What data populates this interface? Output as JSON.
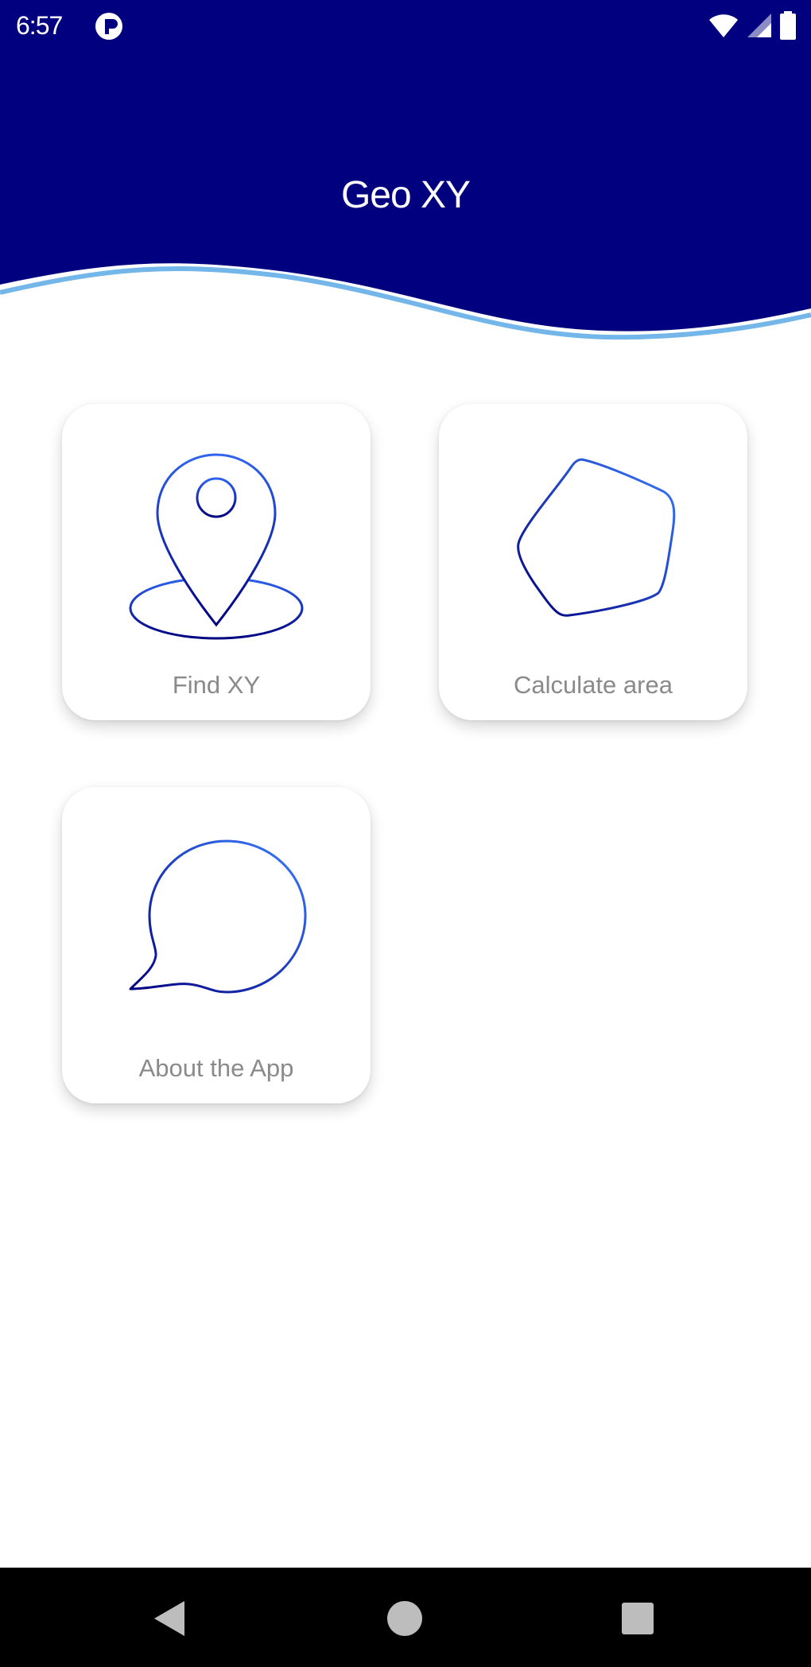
{
  "status_bar": {
    "time": "6:57",
    "icons": [
      "app-notification-icon",
      "wifi-icon",
      "cellular-signal-icon",
      "battery-icon"
    ]
  },
  "header": {
    "title": "Geo XY",
    "background_color": "#01017f",
    "wave_accent_color": "#5aa9e6"
  },
  "menu": {
    "items": [
      {
        "label": "Find XY",
        "icon": "location-pin-icon"
      },
      {
        "label": "Calculate area",
        "icon": "polygon-icon"
      },
      {
        "label": "About the App",
        "icon": "speech-bubble-icon"
      }
    ]
  },
  "theme": {
    "icon_gradient": [
      "#2a4ee6",
      "#01017f"
    ],
    "label_color": "#8a8a8a"
  },
  "nav_bar": {
    "buttons": [
      "back-icon",
      "home-icon",
      "recents-icon"
    ]
  }
}
